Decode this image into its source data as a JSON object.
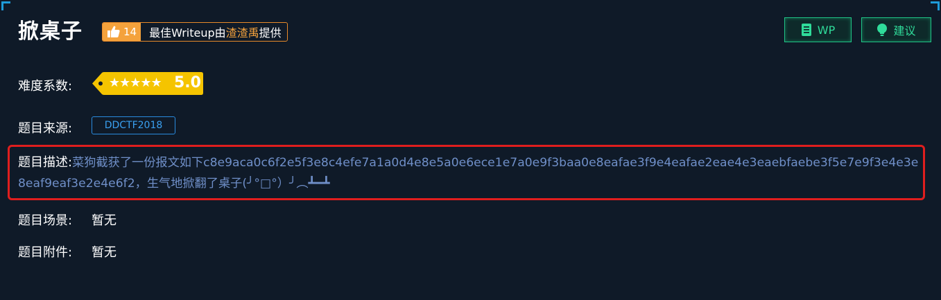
{
  "challenge": {
    "title": "掀桌子",
    "likes": "14",
    "best_writeup_prefix": "最佳Writeup由",
    "best_writeup_author": "渣渣禹",
    "best_writeup_suffix": "提供"
  },
  "buttons": {
    "wp_label": "WP",
    "suggest_label": "建议"
  },
  "difficulty": {
    "label": "难度系数:",
    "stars_text": "★★★★★",
    "score": "5.0",
    "stars": 5,
    "tag_color": "#f5c400"
  },
  "source": {
    "label": "题目来源:",
    "value": "DDCTF2018"
  },
  "description": {
    "label": "题目描述:",
    "text": "菜狗截获了一份报文如下c8e9aca0c6f2e5f3e8c4efe7a1a0d4e8e5a0e6ece1e7a0e9f3baa0e8eafae3f9e4eafae2eae4e3eaebfaebe3f5e7e9f3e4e3e8eaf9eaf3e2e4e6f2，生气地掀翻了桌子(╯°□°）╯︵┻━┻"
  },
  "scene": {
    "label": "题目场景:",
    "value": "暂无"
  },
  "attachment": {
    "label": "题目附件:",
    "value": "暂无"
  },
  "colors": {
    "background": "#0f1a28",
    "accent_green": "#1fc486",
    "accent_orange": "#f4a23c",
    "accent_blue": "#2a8ce0",
    "highlight_red": "#e01e1e"
  }
}
